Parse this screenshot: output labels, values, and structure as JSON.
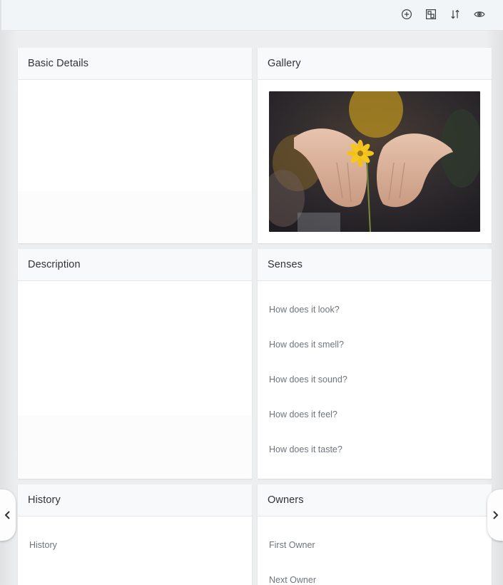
{
  "toolbar": {
    "icons": [
      "add-circle-icon",
      "layout-icon",
      "sort-icon",
      "eye-icon"
    ]
  },
  "cards": {
    "basic_details": {
      "title": "Basic Details"
    },
    "gallery": {
      "title": "Gallery",
      "image": "hands-holding-yellow-flower"
    },
    "description": {
      "title": "Description"
    },
    "senses": {
      "title": "Senses",
      "fields": [
        "How does it look?",
        "How does it smell?",
        "How does it sound?",
        "How does it feel?",
        "How does it taste?"
      ]
    },
    "history": {
      "title": "History",
      "fields": [
        "History"
      ]
    },
    "owners": {
      "title": "Owners",
      "fields": [
        "First Owner",
        "Next Owner"
      ]
    }
  },
  "nav": {
    "left_icon": "chevron-left-icon",
    "right_icon": "chevron-right-icon"
  },
  "colors": {
    "card_bg": "#ffffff",
    "page_bg": "#eceeef",
    "topbar_bg": "#f2f5f8",
    "flower": "#f2c21b"
  }
}
